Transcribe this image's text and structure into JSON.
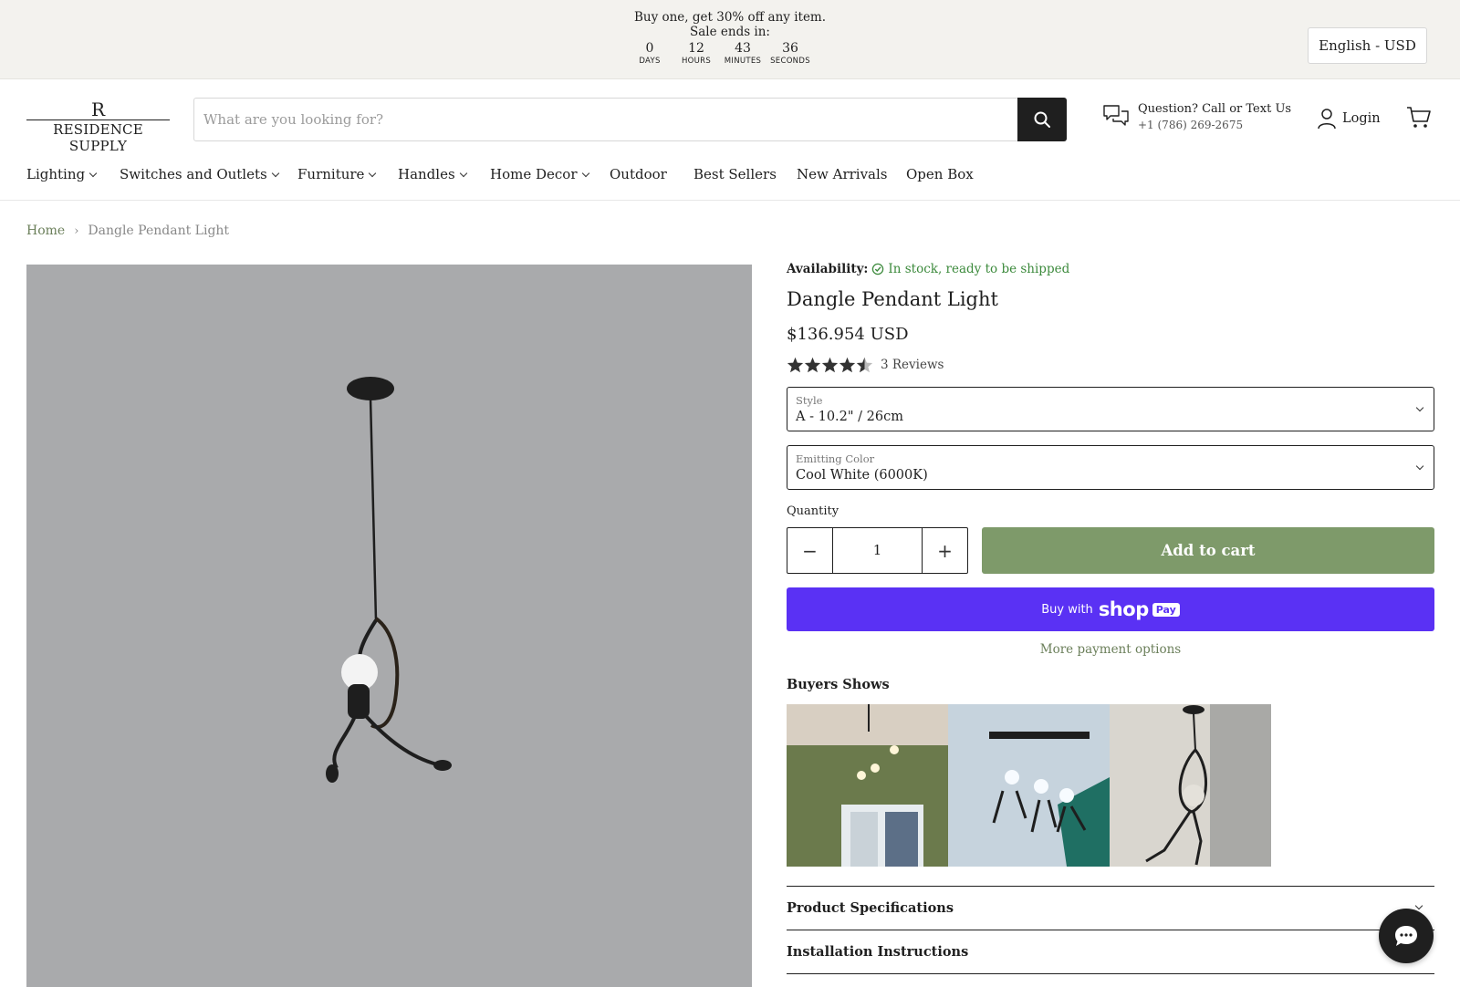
{
  "promo": {
    "line1": "Buy one, get 30% off any item.",
    "line2": "Sale ends in:",
    "countdown": [
      {
        "num": "0",
        "label": "DAYS"
      },
      {
        "num": "12",
        "label": "HOURS"
      },
      {
        "num": "43",
        "label": "MINUTES"
      },
      {
        "num": "36",
        "label": "SECONDS"
      }
    ],
    "language": "English - USD"
  },
  "header": {
    "logo_mark": "R",
    "logo_text": "RESIDENCE SUPPLY",
    "search_placeholder": "What are you looking for?",
    "contact_line1": "Question? Call or Text Us",
    "contact_line2": "+1 (786) 269-2675",
    "login": "Login"
  },
  "nav": {
    "items": [
      {
        "label": "Lighting",
        "dropdown": true
      },
      {
        "label": "Switches and Outlets",
        "dropdown": true
      },
      {
        "label": "Furniture",
        "dropdown": true
      },
      {
        "label": "Handles",
        "dropdown": true
      },
      {
        "label": "Home Decor",
        "dropdown": true
      },
      {
        "label": "Outdoor",
        "dropdown": false
      },
      {
        "label": "Best Sellers",
        "dropdown": false
      },
      {
        "label": "New Arrivals",
        "dropdown": false
      },
      {
        "label": "Open Box",
        "dropdown": false
      }
    ]
  },
  "breadcrumb": {
    "home": "Home",
    "separator": "›",
    "current": "Dangle Pendant Light"
  },
  "product": {
    "availability_label": "Availability:",
    "availability_value": "In stock, ready to be shipped",
    "title": "Dangle Pendant Light",
    "price": "$136.954 USD",
    "rating": 4.5,
    "reviews": "3 Reviews",
    "style_label": "Style",
    "style_value": "A - 10.2\" / 26cm",
    "color_label": "Emitting Color",
    "color_value": "Cool White (6000K)",
    "quantity_label": "Quantity",
    "quantity_minus": "−",
    "quantity_value": "1",
    "quantity_plus": "+",
    "add_to_cart": "Add to cart",
    "buy_with": "Buy with",
    "shop": "shop",
    "pay": "Pay",
    "more_payment": "More payment options",
    "buyers_shows": "Buyers Shows",
    "accordion": [
      "Product Specifications",
      "Installation Instructions"
    ]
  },
  "colors": {
    "accent_green": "#7e9a6a",
    "shop_pay_purple": "#5a31f4",
    "in_stock_green": "#3c8a3c",
    "promo_bg": "#f3f2ee"
  }
}
